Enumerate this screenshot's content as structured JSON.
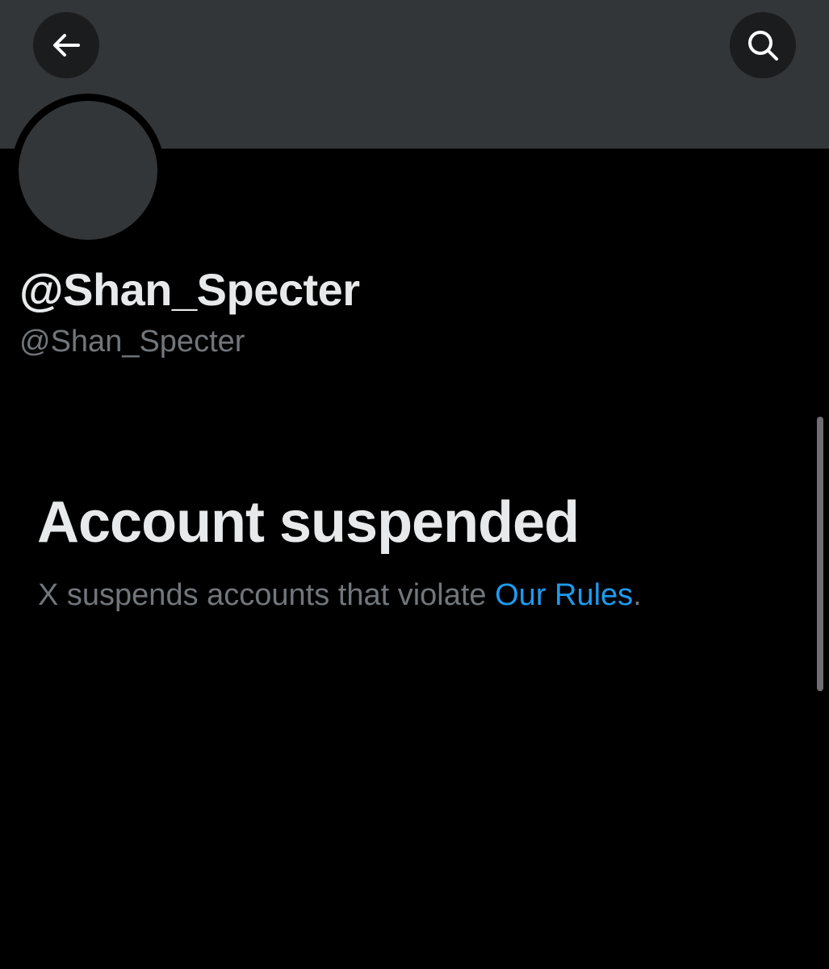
{
  "header": {
    "back_icon": "arrow-left-icon",
    "search_icon": "search-icon"
  },
  "profile": {
    "display_name": "@Shan_Specter",
    "handle": "@Shan_Specter"
  },
  "notice": {
    "title": "Account suspended",
    "description_prefix": "X suspends accounts that violate ",
    "rules_link": "Our Rules",
    "description_suffix": "."
  },
  "colors": {
    "background": "#000000",
    "banner": "#333639",
    "primary_text": "#e7e9ea",
    "secondary_text": "#71767b",
    "link": "#1d9bf0"
  }
}
